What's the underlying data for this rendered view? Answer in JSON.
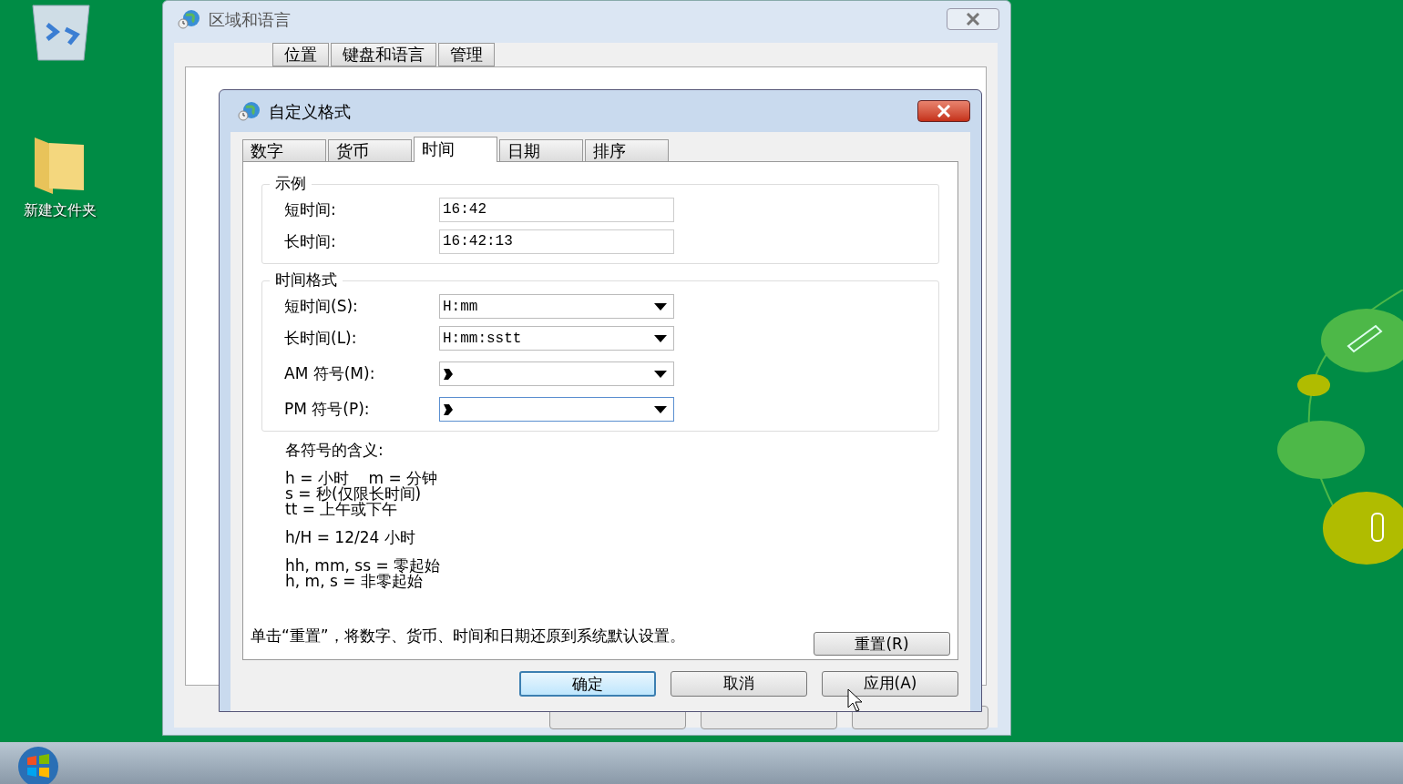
{
  "desktop_icons": [
    {
      "label": "新建文件夹"
    }
  ],
  "background_window": {
    "title": "区域和语言",
    "tabs": [
      {
        "label": "位置",
        "selected": false
      },
      {
        "label": "键盘和语言",
        "selected": false
      },
      {
        "label": "管理",
        "selected": false
      }
    ]
  },
  "dialog": {
    "title": "自定义格式",
    "tabs": [
      {
        "label": "数字",
        "selected": false
      },
      {
        "label": "货币",
        "selected": false
      },
      {
        "label": "时间",
        "selected": true
      },
      {
        "label": "日期",
        "selected": false
      },
      {
        "label": "排序",
        "selected": false
      }
    ],
    "example": {
      "title": "示例",
      "fields": [
        {
          "label": "短时间:",
          "value": "16:42"
        },
        {
          "label": "长时间:",
          "value": "16:42:13"
        }
      ]
    },
    "time_format": {
      "title": "时间格式",
      "fields": [
        {
          "label": "短时间(S):",
          "value": "H:mm",
          "focused": false
        },
        {
          "label": "长时间(L):",
          "value": "H:mm:sstt",
          "focused": false
        },
        {
          "label": "AM 符号(M):",
          "focused": false
        },
        {
          "label": "PM 符号(P):",
          "focused": true
        }
      ]
    },
    "legend_title": "各符号的含义:",
    "legend_groups": [
      [
        "h = 小时    m = 分钟",
        "s = 秒(仅限长时间)",
        "tt = 上午或下午"
      ],
      [
        "h/H = 12/24 小时"
      ],
      [
        "hh, mm, ss = 零起始",
        "h, m, s = 非零起始"
      ]
    ],
    "reset_text": "单击“重置”，将数字、货币、时间和日期还原到系统默认设置。",
    "reset_button": "重置(R)",
    "buttons": [
      {
        "label": "确定",
        "default": true
      },
      {
        "label": "取消",
        "default": false
      },
      {
        "label": "应用(A)",
        "default": false
      }
    ]
  }
}
